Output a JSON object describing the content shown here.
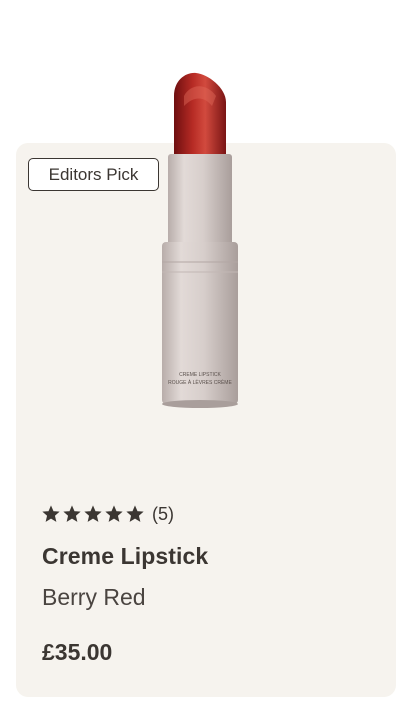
{
  "badge": {
    "label": "Editors Pick"
  },
  "product": {
    "name": "Creme Lipstick",
    "variant": "Berry Red",
    "price": "£35.00",
    "image": {
      "icon": "lipstick-image",
      "tube_text_line1": "CREME LIPSTICK",
      "tube_text_line2": "ROUGE À LÈVRES CRÈME"
    }
  },
  "rating": {
    "stars": 5,
    "max_stars": 5,
    "count_label": "(5)"
  },
  "colors": {
    "card_background": "#f6f3ee",
    "text": "#3b3632",
    "lipstick_red": "#a5231f",
    "tube": "#d9d0cd"
  }
}
